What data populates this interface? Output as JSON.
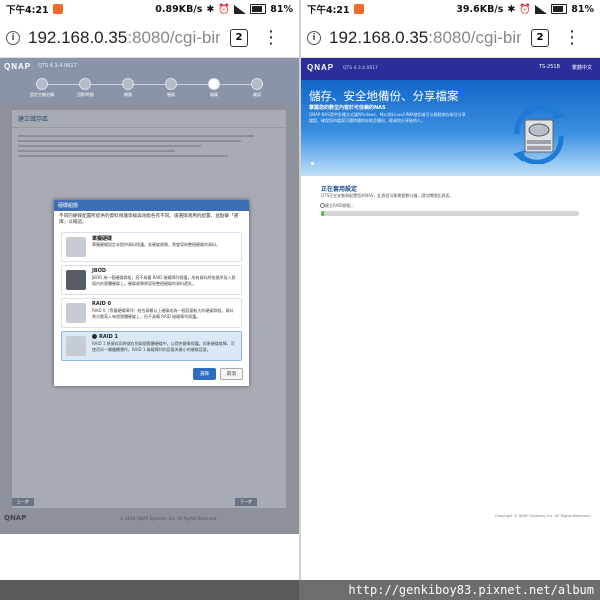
{
  "status_left": {
    "time": "下午4:21",
    "net": "0.89KB/s",
    "battery": "81%"
  },
  "status_right": {
    "time": "下午4:21",
    "net": "39.6KB/s",
    "battery": "81%"
  },
  "browser": {
    "url_host": "192.168.0.35",
    "url_rest": ":8080/cgi-bin",
    "tab_count": "2"
  },
  "left_page": {
    "logo": "QNAP",
    "version": "QTS 4.3.4.0617",
    "steps": [
      "設定主機名稱",
      "日期/時間",
      "網路",
      "服務",
      "磁碟",
      "確認"
    ],
    "section_title": "建立儲存區",
    "dialog": {
      "title": "硬碟組態",
      "description": "不同的硬碟配置所提供的資料保護等級與效能各有不同。請選擇適用的配置，並點擊「選擇」以確認。",
      "options": [
        {
          "name": "單獨硬碟",
          "desc": "單獨硬碟設定未提供資料保護。若硬碟故障，將會導致整個硬碟的資料。",
          "selected": false
        },
        {
          "name": "JBOD",
          "desc": "JBOD 為一個硬碟群組，您不具備 RAID 磁碟陣列保護，所有資料將依據序寫入群組內的實體硬碟上。硬碟故障將導致整個硬碟的資料遺失。",
          "selected": false
        },
        {
          "name": "RAID 0",
          "desc": "RAID 0（等量硬碟陣列）結合兩顆以上硬碟成為一個容量較大的硬碟群組。資料將分散寫入每個實體硬碟上，但不具備 RAID 磁碟陣列保護。",
          "selected": false
        },
        {
          "name": "RAID 1",
          "desc": "RAID 1 將資料同時儲存到兩個實體硬碟中，以提供鏡像保護。如果硬碟故障，可使用另一顆繼續運作。RAID 1 磁碟陣列的容量為最小的硬碟容量。",
          "selected": true
        }
      ],
      "ok_label": "選擇",
      "cancel_label": "取消"
    },
    "footer_logo": "QNAP",
    "footer_copyright": "© 2018 QNAP Systems, Inc. All Rights Reserved.",
    "back_label": "上一步",
    "next_label": "下一步"
  },
  "right_page": {
    "logo": "QNAP",
    "version": "QTS 4.3.4.0617",
    "device": "TS-251B",
    "language": "繁體中文",
    "banner_title": "儲存、安全地備份、分享檔案",
    "banner_sub": "掌握您的數位內容於可信賴的NAS",
    "banner_desc": "QNAP NAS提供多種方式讓Windows、Mac與Linux/UNIX使用者可以輕鬆地存取及分享檔案，確保您的檔案可隨時隨地存取及備份，輕易地分享給他人。",
    "status_title": "正在套用設定",
    "status_desc": "QTS正在安裝和配置您的NAS，此過程可能需要數分鐘，請勿關閉此頁面。",
    "progress_label": "建立RAID群組...",
    "progress": 0.01,
    "footer_copyright": "Copyright © QNAP Systems, Inc. All Rights Reserved."
  },
  "watermark": "http://genkiboy83.pixnet.net/album"
}
